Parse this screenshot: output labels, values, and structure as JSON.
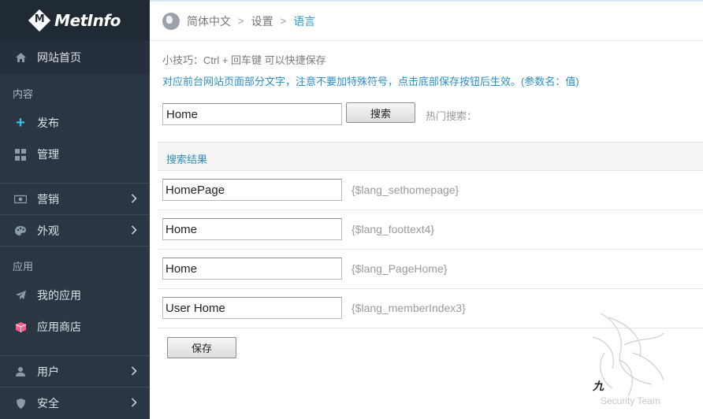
{
  "sidebar": {
    "logo": {
      "text": "MetInfo",
      "mark": "M"
    },
    "home": {
      "label": "网站首页",
      "icon": "home-icon"
    },
    "sections": {
      "content": "内容",
      "apps": "应用"
    },
    "content_items": [
      {
        "label": "发布",
        "icon": "plus-icon"
      },
      {
        "label": "管理",
        "icon": "grid-icon"
      }
    ],
    "group_items": [
      {
        "label": "营销",
        "icon": "money-icon"
      },
      {
        "label": "外观",
        "icon": "palette-icon"
      }
    ],
    "app_items": [
      {
        "label": "我的应用",
        "icon": "paper-plane-icon"
      },
      {
        "label": "应用商店",
        "icon": "cube-icon"
      }
    ],
    "bottom_items": [
      {
        "label": "用户",
        "icon": "user-icon"
      },
      {
        "label": "安全",
        "icon": "shield-icon"
      }
    ]
  },
  "breadcrumb": {
    "items": [
      "简体中文",
      "设置",
      "语言"
    ],
    "icon": "globe-icon"
  },
  "tip": "小技巧：Ctrl + 回车键 可以快捷保存",
  "notice": "对应前台网站页面部分文字，注意不要加特殊符号，点击底部保存按钮后生效。(参数名：值)",
  "search": {
    "value": "Home",
    "button": "搜索",
    "hot_label": "热门搜索："
  },
  "results": {
    "heading": "搜索结果",
    "rows": [
      {
        "value": "HomePage",
        "key": "{$lang_sethomepage}"
      },
      {
        "value": "Home",
        "key": "{$lang_foottext4}"
      },
      {
        "value": "Home",
        "key": "{$lang_PageHome}"
      },
      {
        "value": "User Home",
        "key": "{$lang_memberIndex3}"
      }
    ]
  },
  "save_button": "保存",
  "watermark": {
    "mark": "九",
    "text": "Security Team"
  },
  "colors": {
    "sidebar": "#2b3643",
    "accent": "#2a9bd6",
    "plus": "#33c3e6",
    "cube": "#ff5c8a"
  }
}
